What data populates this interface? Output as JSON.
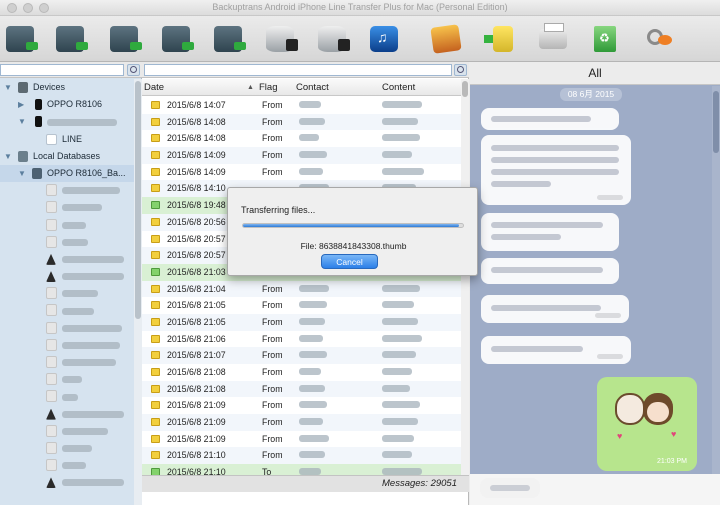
{
  "window": {
    "title": "Backuptrans Android iPhone Line Transfer Plus for Mac (Personal Edition)"
  },
  "toolbar": {
    "buttons": [
      {
        "name": "backup-to-computer-button",
        "icon": "phone-to-computer-icon"
      },
      {
        "name": "transfer-android-to-iphone-button",
        "icon": "phones-transfer-icon"
      },
      {
        "name": "transfer-iphone-to-android-button",
        "icon": "phones-transfer-icon"
      },
      {
        "name": "transfer-phone-to-phone-button",
        "icon": "phones-transfer-icon"
      },
      {
        "name": "restore-to-android-button",
        "icon": "phone-transfer-icon"
      },
      {
        "name": "restore-from-database-button",
        "icon": "database-to-phone-icon"
      },
      {
        "name": "restore-to-iphone-button",
        "icon": "database-to-phone-icon"
      },
      {
        "name": "export-to-itunes-button",
        "icon": "itunes-icon"
      },
      {
        "name": "export-photos-button",
        "icon": "photos-icon"
      },
      {
        "name": "export-notes-button",
        "icon": "note-export-icon"
      },
      {
        "name": "print-button",
        "icon": "printer-icon"
      },
      {
        "name": "delete-button",
        "icon": "recycle-trash-icon"
      },
      {
        "name": "register-button",
        "icon": "key-icon"
      }
    ]
  },
  "sidebar": {
    "devices_label": "Devices",
    "device_name": "OPPO R8106",
    "line_label": "LINE",
    "local_db_label": "Local Databases",
    "db_name": "OPPO R8106_Ba..."
  },
  "table": {
    "headers": {
      "date": "Date",
      "flag": "Flag",
      "contact": "Contact",
      "content": "Content"
    },
    "rows": [
      {
        "date": "2015/6/8 14:07",
        "flag": "From",
        "green": false
      },
      {
        "date": "2015/6/8 14:08",
        "flag": "From",
        "green": false
      },
      {
        "date": "2015/6/8 14:08",
        "flag": "From",
        "green": false
      },
      {
        "date": "2015/6/8 14:09",
        "flag": "From",
        "green": false
      },
      {
        "date": "2015/6/8 14:09",
        "flag": "From",
        "green": false
      },
      {
        "date": "2015/6/8 14:10",
        "flag": "",
        "green": false
      },
      {
        "date": "2015/6/8 19:48",
        "flag": "",
        "green": true
      },
      {
        "date": "2015/6/8 20:56",
        "flag": "",
        "green": false
      },
      {
        "date": "2015/6/8 20:57",
        "flag": "",
        "green": false
      },
      {
        "date": "2015/6/8 20:57",
        "flag": "",
        "green": false
      },
      {
        "date": "2015/6/8 21:03",
        "flag": "To",
        "green": true
      },
      {
        "date": "2015/6/8 21:04",
        "flag": "From",
        "green": false
      },
      {
        "date": "2015/6/8 21:05",
        "flag": "From",
        "green": false
      },
      {
        "date": "2015/6/8 21:05",
        "flag": "From",
        "green": false
      },
      {
        "date": "2015/6/8 21:06",
        "flag": "From",
        "green": false
      },
      {
        "date": "2015/6/8 21:07",
        "flag": "From",
        "green": false
      },
      {
        "date": "2015/6/8 21:08",
        "flag": "From",
        "green": false
      },
      {
        "date": "2015/6/8 21:08",
        "flag": "From",
        "green": false
      },
      {
        "date": "2015/6/8 21:09",
        "flag": "From",
        "green": false
      },
      {
        "date": "2015/6/8 21:09",
        "flag": "From",
        "green": false
      },
      {
        "date": "2015/6/8 21:09",
        "flag": "From",
        "green": false
      },
      {
        "date": "2015/6/8 21:10",
        "flag": "From",
        "green": false
      },
      {
        "date": "2015/6/8 21:10",
        "flag": "To",
        "green": true
      }
    ],
    "message_count": "Messages: 29051"
  },
  "dialog": {
    "title": "Transferring files...",
    "file": "File: 8638841843308.thumb",
    "progress": 0.98,
    "cancel_label": "Cancel"
  },
  "chat": {
    "header": "All",
    "date_pill": "08 6月 2015",
    "sticker_time": "21:03 PM"
  },
  "colors": {
    "accent": "#2d7ad6",
    "selection": "#c5d7ea",
    "chat_bg": "#9eacc7",
    "sticker_bg": "#b7e58d"
  }
}
